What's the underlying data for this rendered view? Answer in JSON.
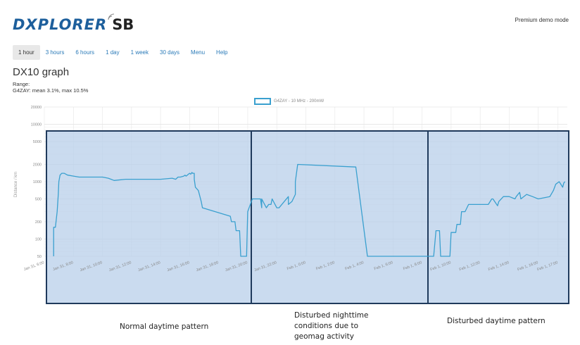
{
  "header": {
    "logo_text": "DXPLORER",
    "logo_suffix": "SB",
    "mode": "Premium demo mode"
  },
  "nav": {
    "tabs": [
      "1 hour",
      "3 hours",
      "6 hours",
      "1 day",
      "1 week",
      "30 days",
      "Menu",
      "Help"
    ],
    "active": "1 hour"
  },
  "page": {
    "title": "DX10 graph",
    "range_label": "Range:",
    "range_value": "G4ZAY: mean 3.1%, max 10.5%"
  },
  "chart_data": {
    "type": "line",
    "ylabel": "Distance / km",
    "xlabel": "",
    "y_scale": "log",
    "ylim": [
      50,
      20000
    ],
    "y_ticks": [
      50,
      100,
      200,
      500,
      1000,
      2000,
      5000,
      10000,
      20000
    ],
    "x_ticks": [
      "Jan 31, 6:00",
      "Jan 31, 8:00",
      "Jan 31, 10:00",
      "Jan 31, 12:00",
      "Jan 31, 14:00",
      "Jan 31, 16:00",
      "Jan 31, 18:00",
      "Jan 31, 20:00",
      "Jan 31, 22:00",
      "Feb 1, 0:00",
      "Feb 1, 2:00",
      "Feb 1, 4:00",
      "Feb 1, 6:00",
      "Feb 1, 8:00",
      "Feb 1, 10:00",
      "Feb 1, 12:00",
      "Feb 1, 14:00",
      "Feb 1, 16:00",
      "Feb 1, 17:00"
    ],
    "legend": "top-center",
    "grid": true,
    "series": [
      {
        "name": "G4ZAY - 10 MHz - 200mW",
        "color": "#3aa0cf",
        "x_hours": [
          0.8,
          0.8,
          0.95,
          1.1,
          1.2,
          1.25,
          1.35,
          1.5,
          1.7,
          2.0,
          2.5,
          3.0,
          4.0,
          5.0,
          5.5,
          6.0,
          7.0,
          8.0,
          9.0,
          10.0,
          11.0,
          11.3,
          11.5,
          11.7,
          12.0,
          12.1,
          12.2,
          12.3,
          12.4,
          12.5,
          12.6,
          12.7,
          12.75,
          12.9,
          12.9,
          13.0,
          13.25,
          13.5,
          13.6,
          16.0,
          16.1,
          16.4,
          16.5,
          16.8,
          16.9,
          17.0,
          17.4,
          17.5,
          17.9,
          18.0,
          18.4,
          18.6,
          18.7,
          18.7,
          19.1,
          19.3,
          19.5,
          19.6,
          19.6,
          20.0,
          20.2,
          21.0,
          21.0,
          21.3,
          21.6,
          21.6,
          21.8,
          26.8,
          26.8,
          27.8,
          27.8,
          33.4,
          33.5,
          33.7,
          33.75,
          34.0,
          34.1,
          34.2,
          34.5,
          34.9,
          35.0,
          35.4,
          35.5,
          35.8,
          35.9,
          36.2,
          36.5,
          37.0,
          37.1,
          37.5,
          37.5,
          38.0,
          38.2,
          38.5,
          38.6,
          39.0,
          39.1,
          39.5,
          40.0,
          40.5,
          40.6,
          40.9,
          41.0,
          41.5,
          42.0,
          42.5,
          43.5,
          43.8,
          44.0,
          44.3,
          44.6,
          44.7,
          44.8
        ],
        "values": [
          50,
          160,
          160,
          300,
          600,
          1000,
          1300,
          1400,
          1400,
          1300,
          1250,
          1200,
          1200,
          1200,
          1150,
          1050,
          1100,
          1100,
          1100,
          1100,
          1150,
          1100,
          1200,
          1200,
          1250,
          1300,
          1250,
          1300,
          1350,
          1400,
          1350,
          1450,
          1400,
          1400,
          1100,
          800,
          700,
          450,
          350,
          250,
          200,
          200,
          140,
          140,
          50,
          50,
          50,
          300,
          500,
          500,
          500,
          500,
          350,
          500,
          350,
          400,
          400,
          500,
          500,
          350,
          350,
          550,
          400,
          450,
          600,
          1000,
          2000,
          1800,
          1800,
          50,
          50,
          50,
          50,
          140,
          140,
          140,
          50,
          50,
          50,
          50,
          130,
          130,
          180,
          180,
          300,
          300,
          400,
          400,
          400,
          400,
          400,
          400,
          400,
          500,
          500,
          380,
          450,
          550,
          550,
          500,
          550,
          650,
          500,
          600,
          550,
          500,
          550,
          700,
          900,
          1000,
          800,
          950,
          1000,
          900,
          1000,
          950,
          1100,
          1150,
          1150,
          1150,
          1100,
          950,
          800,
          500,
          650,
          650
        ]
      }
    ]
  },
  "annotations": [
    {
      "text": "Normal daytime pattern"
    },
    {
      "text": "Disturbed nighttime conditions due to geomag activity"
    },
    {
      "text": "Disturbed daytime pattern"
    }
  ],
  "style": {
    "accent": "#2a7ab8",
    "overlay_fill": "#b8cfea",
    "overlay_stroke": "#1f3a5c",
    "line_color": "#3aa0cf"
  }
}
